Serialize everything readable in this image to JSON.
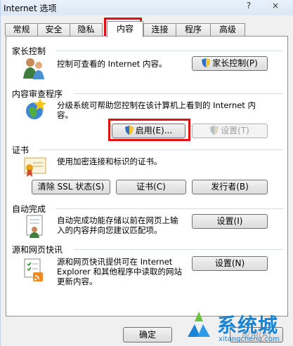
{
  "window": {
    "title": "Internet 选项",
    "help": "?",
    "close": "×"
  },
  "tabs": [
    {
      "label": "常规"
    },
    {
      "label": "安全"
    },
    {
      "label": "隐私"
    },
    {
      "label": "内容"
    },
    {
      "label": "连接"
    },
    {
      "label": "程序"
    },
    {
      "label": "高级"
    }
  ],
  "active_tab": "内容",
  "parental": {
    "title": "家长控制",
    "desc": "控制可查看的 Internet 内容。",
    "button": "家长控制(P)"
  },
  "advisor": {
    "title": "内容审查程序",
    "desc_line1": "分级系统可帮助您控制在该计算机上看到的 Internet 内",
    "desc_line2": "容。",
    "enable_button": "启用(E)...",
    "settings_button": "设置(T)"
  },
  "certs": {
    "title": "证书",
    "desc": "使用加密连接和标识的证书。",
    "clear_ssl": "清除 SSL 状态(S)",
    "certificates": "证书(C)",
    "publishers": "发行者(B)"
  },
  "autocomplete": {
    "title": "自动完成",
    "desc_line1": "自动完成功能存储以前在网页上输",
    "desc_line2": "入的内容并向您建议匹配项。",
    "settings": "设置(I)"
  },
  "feeds": {
    "title": "源和网页快讯",
    "desc_line1": "源和网页快讯提供可在 Internet",
    "desc_line2": "Explorer 和其他程序中读取的网站",
    "desc_line3": "更新内容。",
    "settings": "设置(N)"
  },
  "footer": {
    "ok": "确定",
    "apply": "应用(A)"
  },
  "watermark": {
    "brand": "系统城",
    "url": "xitongcheng.com"
  },
  "colors": {
    "highlight": "#dd1111",
    "watermark_blue": "#1a84d6"
  }
}
